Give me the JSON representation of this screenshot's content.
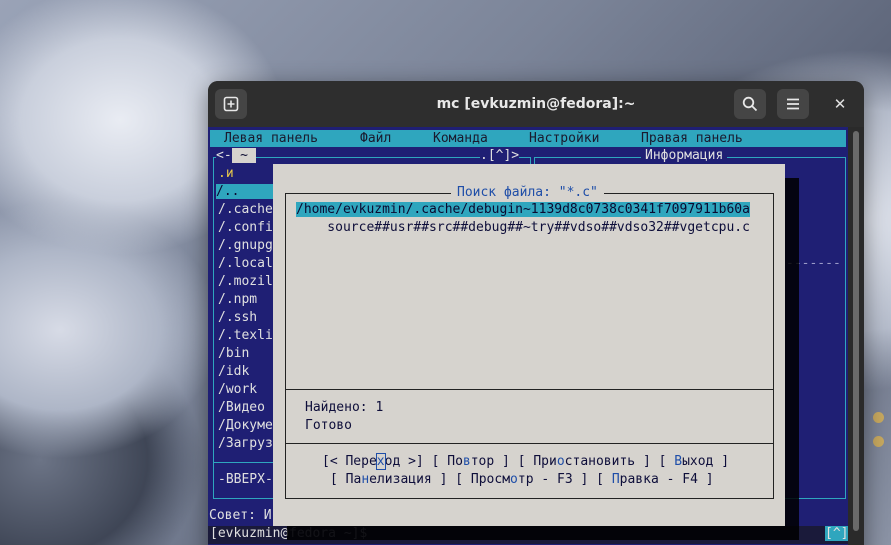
{
  "window": {
    "title": "mc [evkuzmin@fedora]:~"
  },
  "menubar": [
    "Левая панель",
    "Файл",
    "Команда",
    "Настройки",
    "Правая панель"
  ],
  "left_panel": {
    "header_left": "<-",
    "header_dir": "~",
    "header_right": ".[^]>",
    "col_header": ".и",
    "entries": [
      "/..",
      "/.cache",
      "/.confi",
      "/.gnupg",
      "/.local",
      "/.mozil",
      "/.npm",
      "/.ssh",
      "/.texli",
      "/bin",
      "/idk",
      "/work",
      "/Видео",
      "/Докуме",
      "/Загруз"
    ],
    "footer": "-ВВЕРХ-"
  },
  "right_panel": {
    "title": "Информация"
  },
  "hint": "Совет: И",
  "prompt": {
    "user": "[evkuzmin@",
    "host": "fedora",
    "path": " ~]$",
    "right_button": "[^]"
  },
  "dialog": {
    "title": "Поиск файла: \"*.c\"",
    "results": [
      "/home/evkuzmin/.cache/debugin~1139d8c0738c0341f7097911b60a",
      "    source##usr##src##debug##~try##vdso##vdso32##vgetcpu.c"
    ],
    "found_label": "Найдено: 1",
    "status": "Готово",
    "buttons_row1": {
      "goto_pre": "[< Пере",
      "goto_hot": "х",
      "goto_post": "од >]",
      "repeat_pre": "[ По",
      "repeat_hot": "в",
      "repeat_post": "тор ]",
      "pause_pre": "[ При",
      "pause_hot": "о",
      "pause_post": "становить ]",
      "exit_pre": "[ ",
      "exit_hot": "В",
      "exit_post": "ыход ]"
    },
    "buttons_row2": {
      "panel_pre": "[ Па",
      "panel_hot": "н",
      "panel_post": "елизация ]",
      "view_pre": "[ Просм",
      "view_hot": "о",
      "view_post": "тр - F3 ]",
      "edit_pre": "[ ",
      "edit_hot": "П",
      "edit_post": "равка - F4 ]"
    }
  },
  "colors": {
    "panel_bg": "#1f1f74",
    "accent": "#2fa6be",
    "dialog_bg": "#d6d3ce",
    "hotkey": "#1f4ea8"
  }
}
